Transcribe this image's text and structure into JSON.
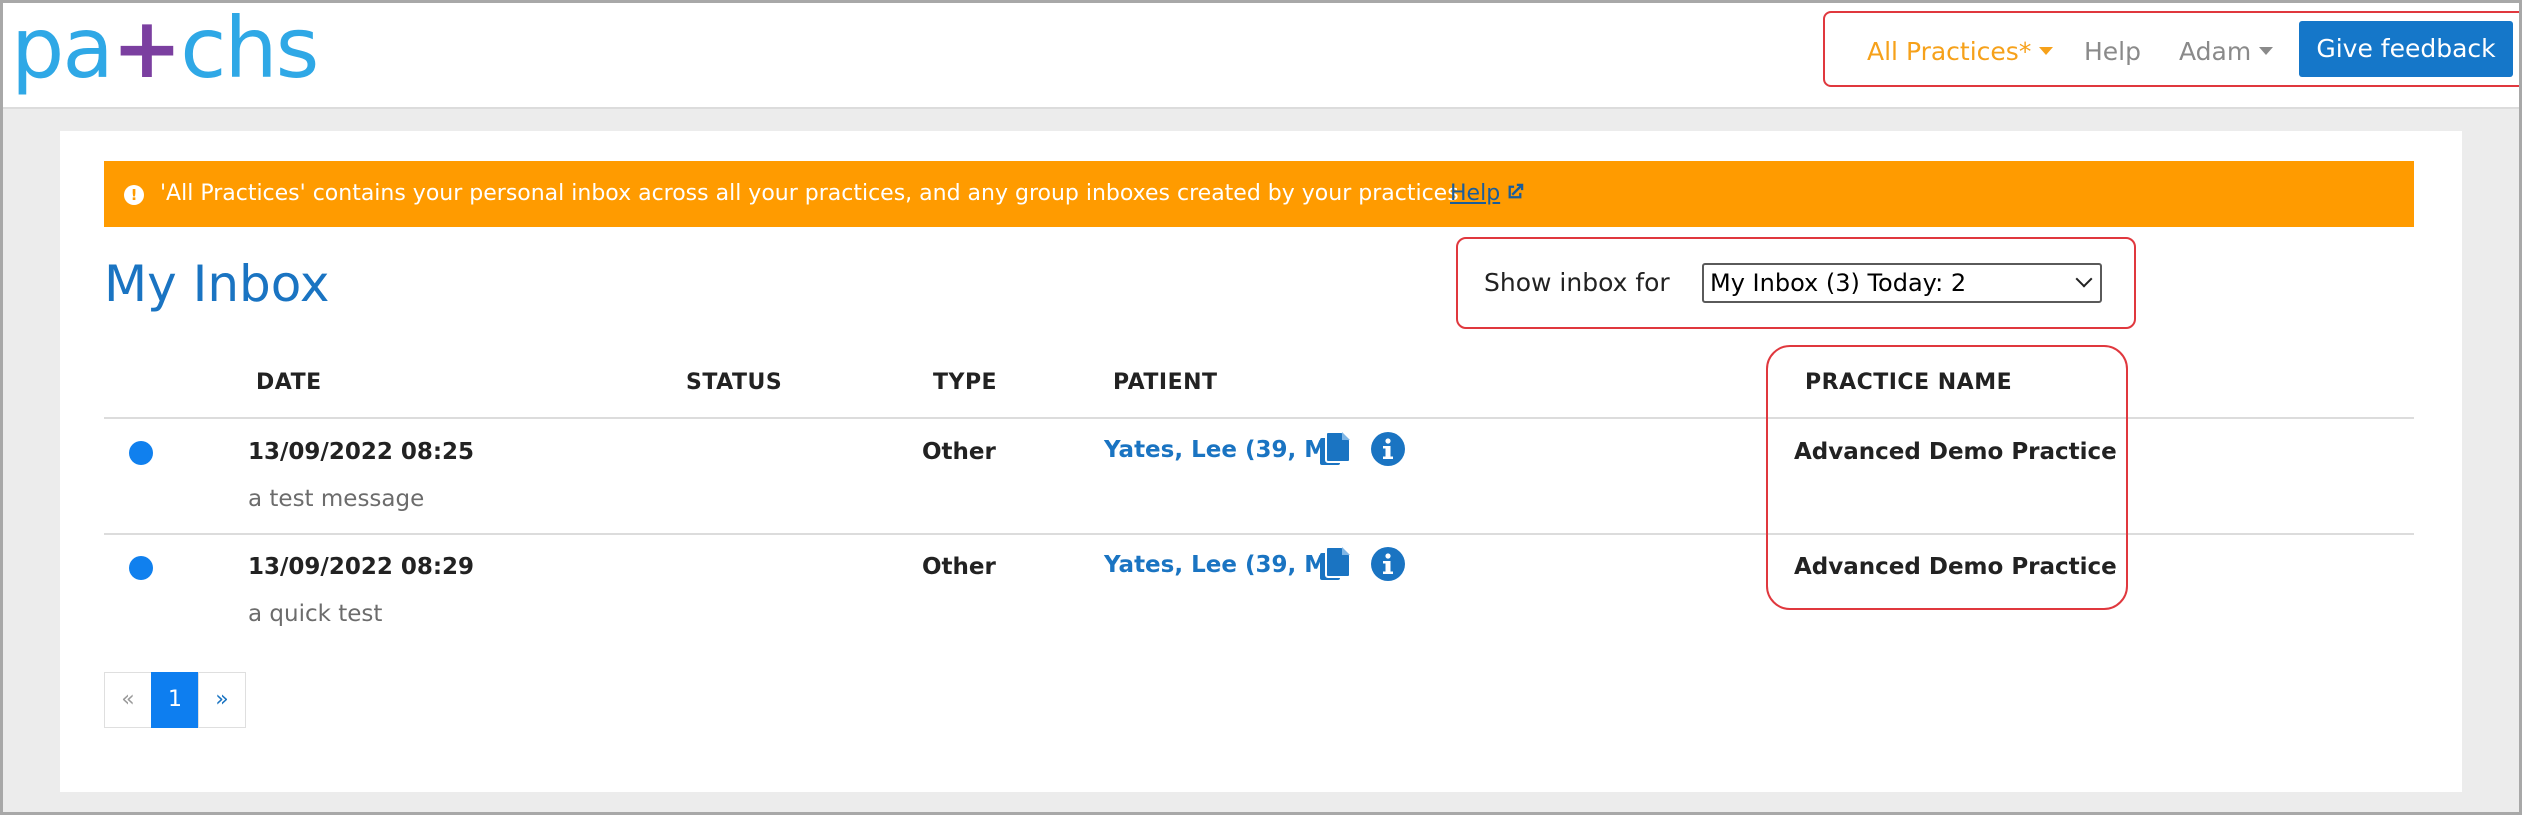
{
  "logo": {
    "pre": "pa",
    "plus": "+",
    "post": "chs"
  },
  "nav": {
    "practices_label": "All Practices*",
    "help_label": "Help",
    "user_label": "Adam",
    "feedback_label": "Give feedback"
  },
  "alert": {
    "icon": "!",
    "text": "'All Practices' contains your personal inbox across all your practices, and any group inboxes created by your practices",
    "link_label": "Help"
  },
  "page_title": "My Inbox",
  "show_inbox": {
    "label": "Show inbox for",
    "selected": "My Inbox (3) Today: 2"
  },
  "table": {
    "headers": {
      "date": "DATE",
      "status": "STATUS",
      "type": "TYPE",
      "patient": "PATIENT",
      "practice": "PRACTICE NAME"
    },
    "rows": [
      {
        "date": "13/09/2022 08:25",
        "preview": "a test message",
        "status": "",
        "type": "Other",
        "patient": "Yates, Lee (39, M)",
        "practice": "Advanced Demo Practice"
      },
      {
        "date": "13/09/2022 08:29",
        "preview": "a quick test",
        "status": "",
        "type": "Other",
        "patient": "Yates, Lee (39, M)",
        "practice": "Advanced Demo Practice"
      }
    ]
  },
  "pagination": {
    "prev": "«",
    "current": "1",
    "next": "»"
  },
  "colors": {
    "brand": "#2fa8e6",
    "accent_orange": "#ff9b00",
    "primary_blue": "#1577c9",
    "unread_dot": "#1080ee",
    "highlight_red": "#e0383e"
  }
}
